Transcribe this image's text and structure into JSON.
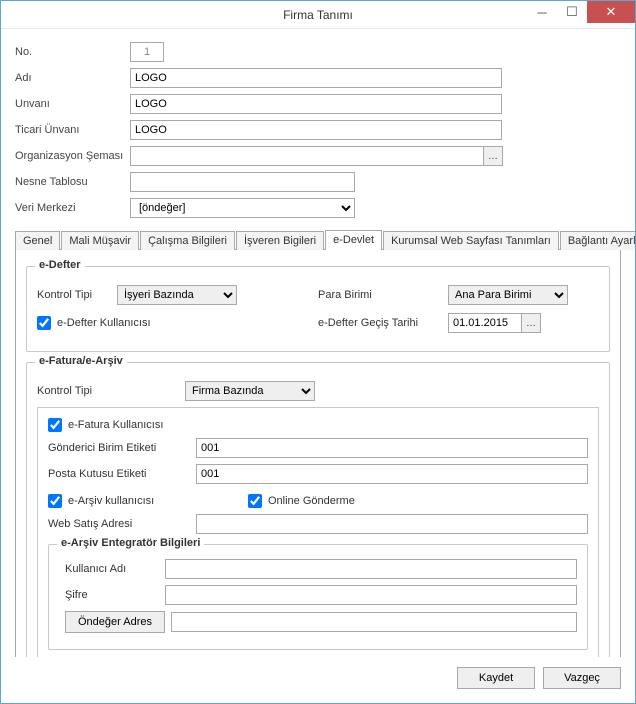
{
  "window": {
    "title": "Firma Tanımı"
  },
  "header": {
    "no_label": "No.",
    "no_value": "1",
    "adi_label": "Adı",
    "adi_value": "LOGO",
    "unvani_label": "Unvanı",
    "unvani_value": "LOGO",
    "ticari_unvani_label": "Ticari Ünvanı",
    "ticari_unvani_value": "LOGO",
    "org_sema_label": "Organizasyon Şeması",
    "org_sema_value": "",
    "nesne_label": "Nesne Tablosu",
    "nesne_value": "",
    "veri_label": "Veri Merkezi",
    "veri_value": "[öndeğer]"
  },
  "tabs": {
    "items": [
      "Genel",
      "Mali Müşavir",
      "Çalışma Bilgileri",
      "İşveren Bigileri",
      "e-Devlet",
      "Kurumsal Web Sayfası Tanımları",
      "Bağlantı Ayarları"
    ],
    "active_index": 4
  },
  "edefter": {
    "legend": "e-Defter",
    "kontrol_tipi_label": "Kontrol Tipi",
    "kontrol_tipi_value": "İşyeri Bazında",
    "para_birimi_label": "Para Birimi",
    "para_birimi_value": "Ana Para Birimi",
    "kullanici_label": "e-Defter Kullanıcısı",
    "gecis_label": "e-Defter Geçiş Tarihi",
    "gecis_value": "01.01.2015"
  },
  "efatura": {
    "legend": "e-Fatura/e-Arşiv",
    "kontrol_tipi_label": "Kontrol Tipi",
    "kontrol_tipi_value": "Firma Bazında",
    "kullanici_label": "e-Fatura Kullanıcısı",
    "gonderici_label": "Gönderici Birim Etiketi",
    "gonderici_value": "001",
    "posta_label": "Posta Kutusu Etiketi",
    "posta_value": "001",
    "earsiv_kullanici_label": "e-Arşiv kullanıcısı",
    "online_label": "Online Gönderme",
    "web_satis_label": "Web Satış Adresi",
    "web_satis_value": "",
    "entegrator": {
      "legend": "e-Arşiv Entegratör Bilgileri",
      "kullanici_adi_label": "Kullanıcı Adı",
      "kullanici_adi_value": "",
      "sifre_label": "Şifre",
      "sifre_value": "",
      "ondeger_adres_btn": "Öndeğer Adres",
      "ondeger_adres_value": ""
    }
  },
  "footer": {
    "save": "Kaydet",
    "cancel": "Vazgeç"
  }
}
